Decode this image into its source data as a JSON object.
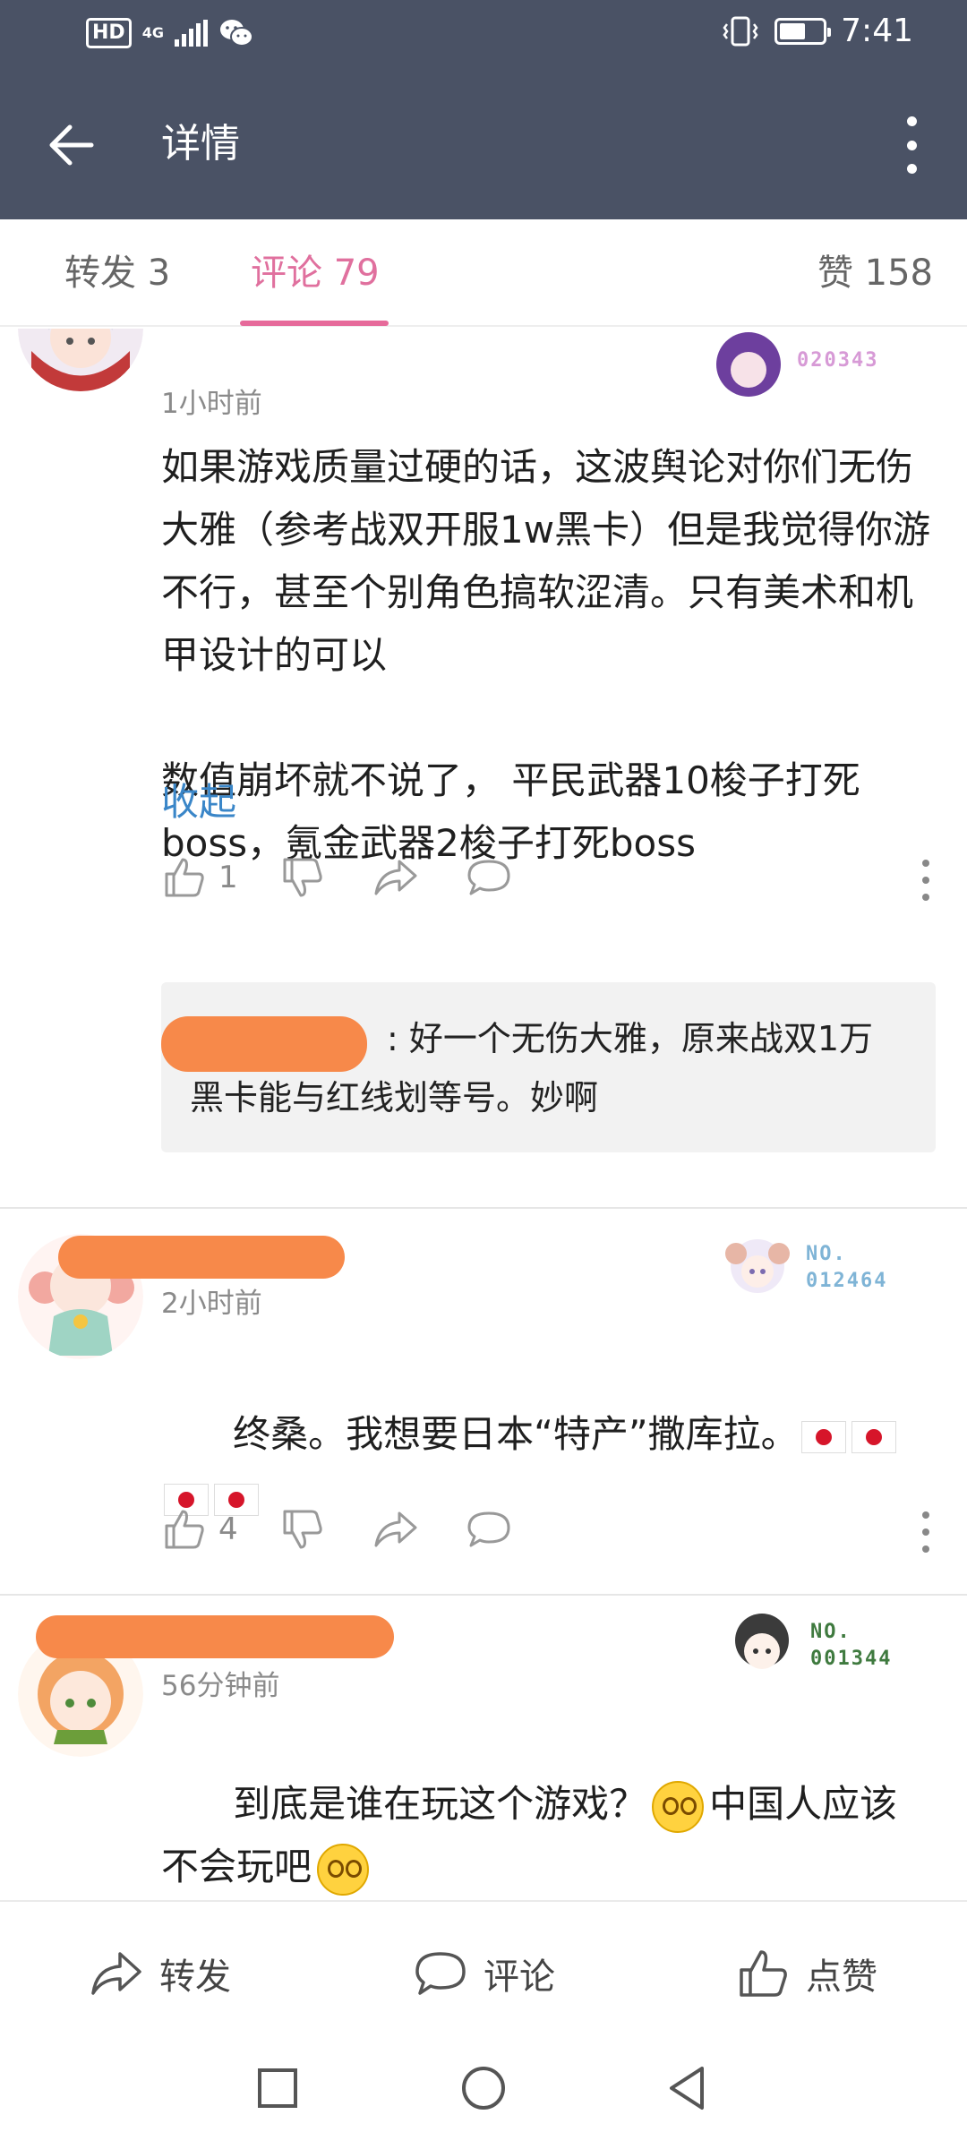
{
  "status_bar": {
    "hd": "HD",
    "network": "4G",
    "time": "7:41"
  },
  "app_bar": {
    "title": "详情"
  },
  "tabs": {
    "repost": "转发 3",
    "comments": "评论 79",
    "likes": "赞 158"
  },
  "comments": [
    {
      "time": "1小时前",
      "badge_no": "020343",
      "text": "如果游戏质量过硬的话，这波舆论对你们无伤大雅（参考战双开服1w黑卡）但是我觉得你游不行，甚至个别角色搞软涩清。只有美术和机甲设计的可以\n\n数值崩坏就不说了， 平民武器10梭子打死boss，氪金武器2梭子打死boss",
      "collapse": "收起",
      "like_count": "1",
      "reply": ": 好一个无伤大雅，原来战双1万黑卡能与红线划等号。妙啊"
    },
    {
      "time": "2小时前",
      "badge_prefix": "NO.",
      "badge_no": "012464",
      "text": "终桑。我想要日本“特产”撒库拉。",
      "like_count": "4"
    },
    {
      "time": "56分钟前",
      "badge_prefix": "NO.",
      "badge_no": "001344",
      "text_part1": "到底是谁在玩这个游戏？",
      "text_part2": "中国人应该不会玩吧"
    }
  ],
  "bottom_bar": {
    "repost": "转发",
    "comment": "评论",
    "like": "点赞"
  },
  "colors": {
    "header_bg": "#4a5265",
    "accent_pink": "#e66a9a",
    "link_blue": "#3a86c8",
    "redaction_orange": "#f7894a"
  }
}
